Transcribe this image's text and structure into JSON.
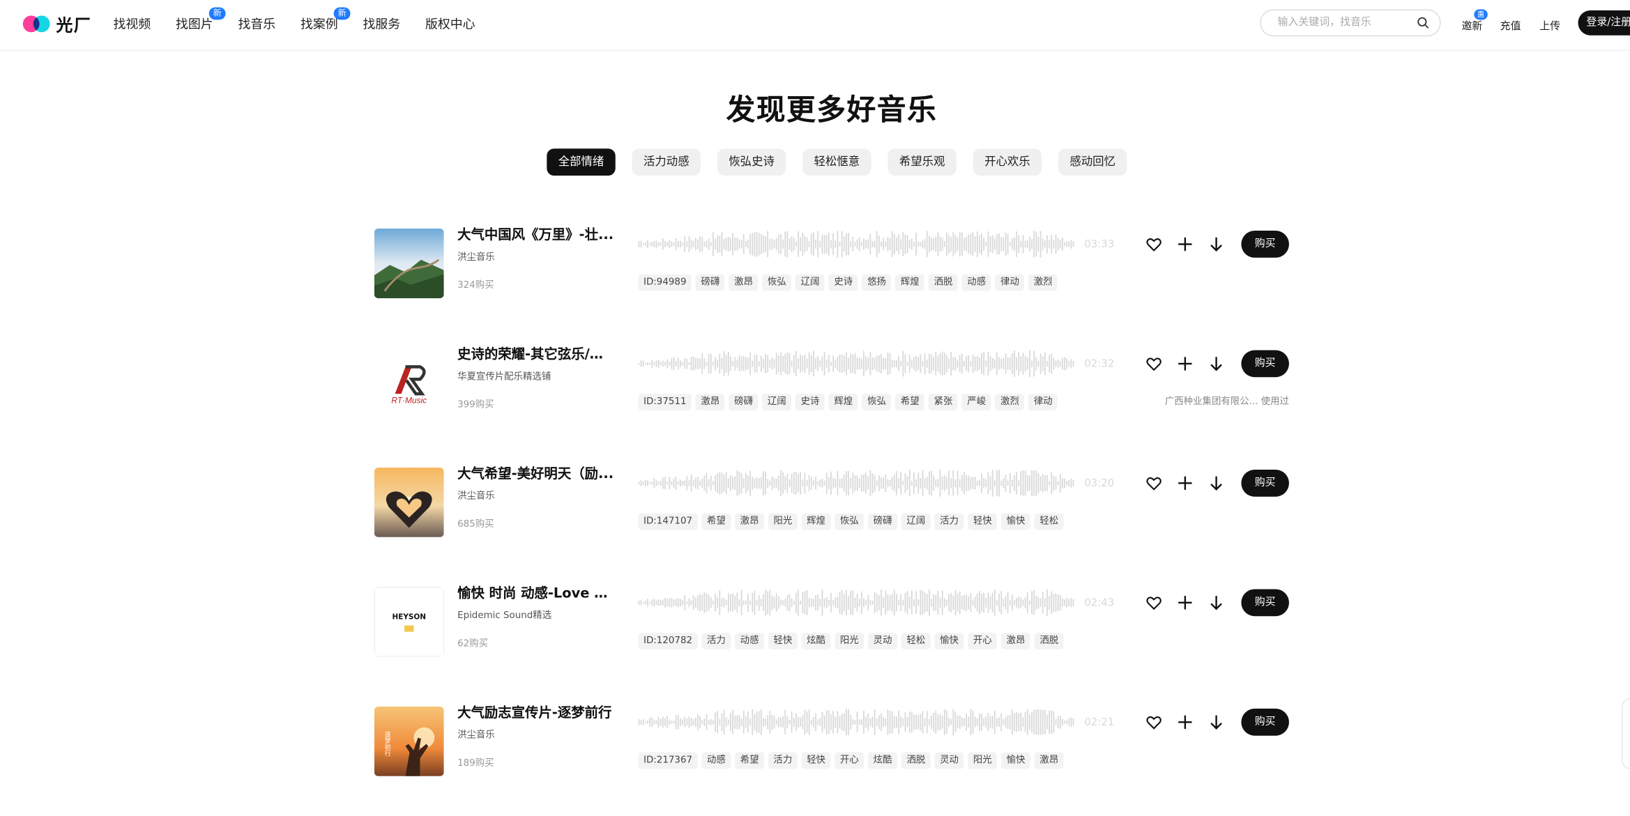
{
  "header": {
    "logo_text": "光厂",
    "nav": [
      {
        "label": "找视频",
        "badge": ""
      },
      {
        "label": "找图片",
        "badge": "新"
      },
      {
        "label": "找音乐",
        "badge": ""
      },
      {
        "label": "找案例",
        "badge": "新"
      },
      {
        "label": "找服务",
        "badge": ""
      },
      {
        "label": "版权中心",
        "badge": ""
      }
    ],
    "search_placeholder": "输入关键词，找音乐",
    "invite_label": "邀新",
    "invite_badge": "惠",
    "recharge_label": "充值",
    "upload_label": "上传",
    "login_label": "登录/注册"
  },
  "main": {
    "title": "发现更多好音乐",
    "filters": [
      "全部情绪",
      "活力动感",
      "恢弘史诗",
      "轻松惬意",
      "希望乐观",
      "开心欢乐",
      "感动回忆"
    ],
    "active_filter": "全部情绪"
  },
  "tracks": [
    {
      "title": "大气中国风《万里》-壮...",
      "artist": "洪尘音乐",
      "sales": "324购买",
      "duration": "03:33",
      "tags": [
        "ID:94989",
        "磅礴",
        "激昂",
        "恢弘",
        "辽阔",
        "史诗",
        "悠扬",
        "辉煌",
        "洒脱",
        "动感",
        "律动",
        "激烈"
      ],
      "used_by": "",
      "buy_label": "购买",
      "cover": "great-wall"
    },
    {
      "title": "史诗的荣耀-其它弦乐/弦...",
      "artist": "华夏宣传片配乐精选铺",
      "sales": "399购买",
      "duration": "02:32",
      "tags": [
        "ID:37511",
        "激昂",
        "磅礴",
        "辽阔",
        "史诗",
        "辉煌",
        "恢弘",
        "希望",
        "紧张",
        "严峻",
        "激烈",
        "律动"
      ],
      "used_by": "广西种业集团有限公... 使用过",
      "buy_label": "购买",
      "cover": "rt-music",
      "cover_text": "RT·Music"
    },
    {
      "title": "大气希望-美好明天（励...",
      "artist": "洪尘音乐",
      "sales": "685购买",
      "duration": "03:20",
      "tags": [
        "ID:147107",
        "希望",
        "激昂",
        "阳光",
        "辉煌",
        "恢弘",
        "磅礴",
        "辽阔",
        "活力",
        "轻快",
        "愉快",
        "轻松"
      ],
      "used_by": "",
      "buy_label": "购买",
      "cover": "heart-sunset"
    },
    {
      "title": "愉快 时尚 动感-Love Love",
      "artist": "Epidemic Sound精选",
      "sales": "62购买",
      "duration": "02:43",
      "tags": [
        "ID:120782",
        "活力",
        "动感",
        "轻快",
        "炫酷",
        "阳光",
        "灵动",
        "轻松",
        "愉快",
        "开心",
        "激昂",
        "洒脱"
      ],
      "used_by": "",
      "buy_label": "购买",
      "cover": "heyson",
      "cover_text": "HEYSON"
    },
    {
      "title": "大气励志宣传片-逐梦前行",
      "artist": "洪尘音乐",
      "sales": "189购买",
      "duration": "02:21",
      "tags": [
        "ID:217367",
        "动感",
        "希望",
        "活力",
        "轻快",
        "开心",
        "炫酷",
        "洒脱",
        "灵动",
        "阳光",
        "愉快",
        "激昂"
      ],
      "used_by": "",
      "buy_label": "购买",
      "cover": "hand-sunset",
      "cover_text": "逐梦前行"
    }
  ]
}
